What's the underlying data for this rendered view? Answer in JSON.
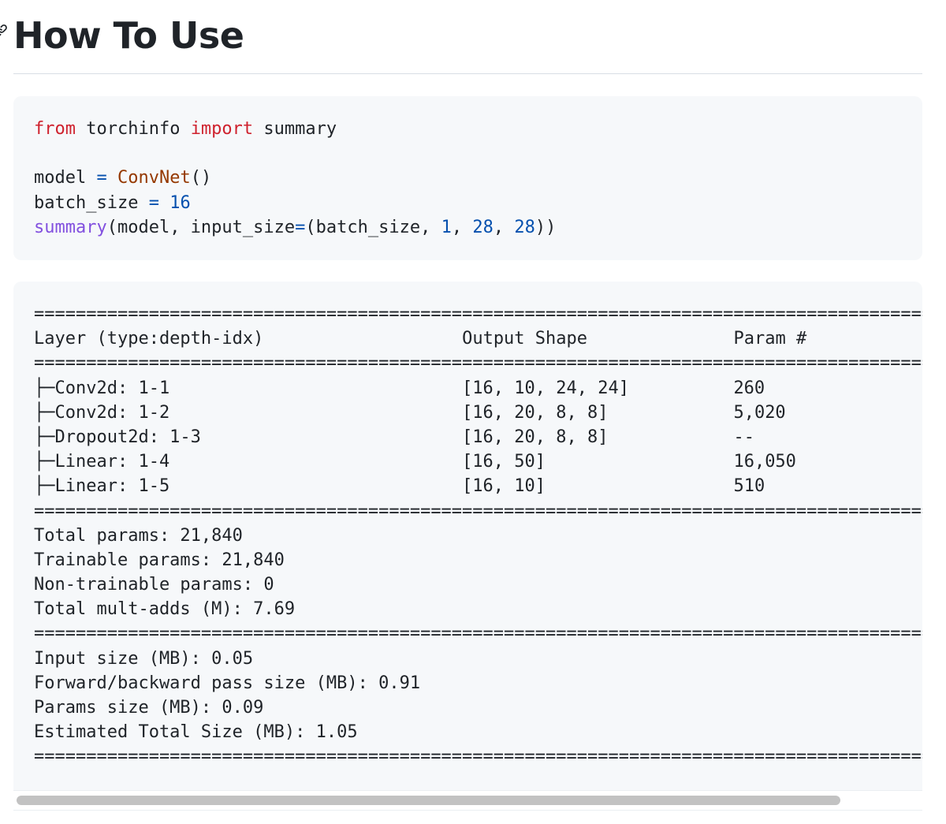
{
  "heading": {
    "title": "How To Use",
    "anchor_icon": "link-icon"
  },
  "usage_code": {
    "language": "python",
    "lines": [
      [
        {
          "t": "from",
          "c": "kw"
        },
        {
          "t": " torchinfo ",
          "c": ""
        },
        {
          "t": "import",
          "c": "kw"
        },
        {
          "t": " summary",
          "c": ""
        }
      ],
      [],
      [
        {
          "t": "model ",
          "c": ""
        },
        {
          "t": "=",
          "c": "op"
        },
        {
          "t": " ",
          "c": ""
        },
        {
          "t": "ConvNet",
          "c": "cls"
        },
        {
          "t": "()",
          "c": ""
        }
      ],
      [
        {
          "t": "batch_size ",
          "c": ""
        },
        {
          "t": "=",
          "c": "op"
        },
        {
          "t": " ",
          "c": ""
        },
        {
          "t": "16",
          "c": "num"
        }
      ],
      [
        {
          "t": "summary",
          "c": "fn"
        },
        {
          "t": "(model, input_size",
          "c": ""
        },
        {
          "t": "=",
          "c": "op"
        },
        {
          "t": "(batch_size, ",
          "c": ""
        },
        {
          "t": "1",
          "c": "num"
        },
        {
          "t": ", ",
          "c": ""
        },
        {
          "t": "28",
          "c": "num"
        },
        {
          "t": ", ",
          "c": ""
        },
        {
          "t": "28",
          "c": "num"
        },
        {
          "t": "))",
          "c": ""
        }
      ]
    ]
  },
  "summary_output": {
    "divider": "==========================================================================================",
    "header": {
      "layer": "Layer (type:depth-idx)",
      "output_shape": "Output Shape",
      "params": "Param #"
    },
    "rows": [
      {
        "layer": "├─Conv2d: 1-1",
        "output_shape": "[16, 10, 24, 24]",
        "params": "260"
      },
      {
        "layer": "├─Conv2d: 1-2",
        "output_shape": "[16, 20, 8, 8]",
        "params": "5,020"
      },
      {
        "layer": "├─Dropout2d: 1-3",
        "output_shape": "[16, 20, 8, 8]",
        "params": "--"
      },
      {
        "layer": "├─Linear: 1-4",
        "output_shape": "[16, 50]",
        "params": "16,050"
      },
      {
        "layer": "├─Linear: 1-5",
        "output_shape": "[16, 10]",
        "params": "510"
      }
    ],
    "totals": [
      "Total params: 21,840",
      "Trainable params: 21,840",
      "Non-trainable params: 0",
      "Total mult-adds (M): 7.69"
    ],
    "sizes": [
      "Input size (MB): 0.05",
      "Forward/backward pass size (MB): 0.91",
      "Params size (MB): 0.09",
      "Estimated Total Size (MB): 1.05"
    ]
  },
  "scrollbar": {
    "position": 0.0
  }
}
